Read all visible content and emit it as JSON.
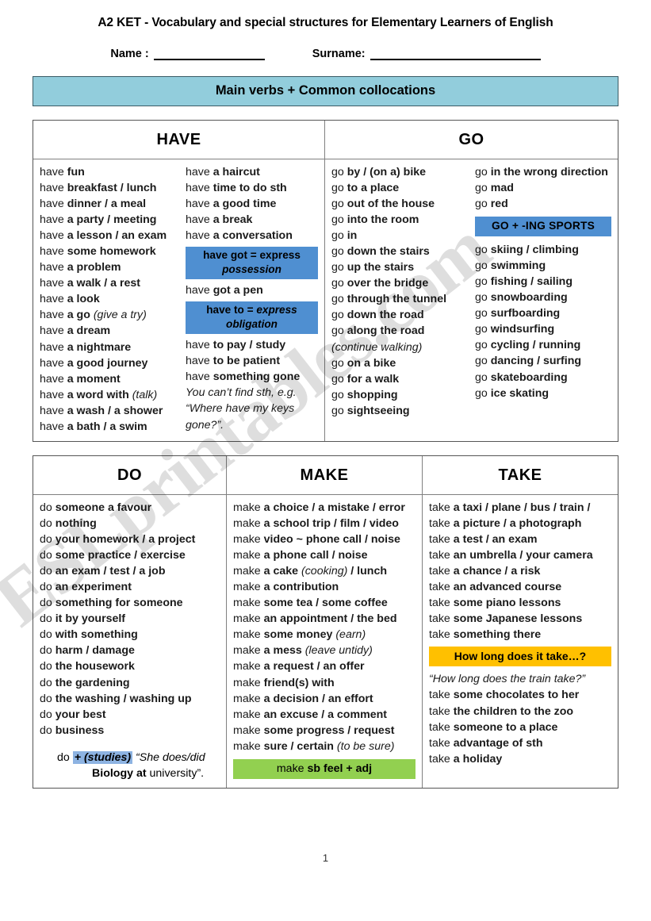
{
  "header": {
    "title": "A2 KET - Vocabulary and special structures for Elementary Learners of English",
    "name_label": "Name :",
    "surname_label": "Surname:",
    "banner": "Main verbs + Common collocations"
  },
  "colors": {
    "banner_bg": "#92CDDC",
    "blue_box": "#4F8FD1",
    "amber_box": "#FFC000",
    "green_box": "#92D050",
    "inline_highlight": "#8DB3E2",
    "table_border": "#555555"
  },
  "tables": [
    {
      "id": "table-verbs-1",
      "headers": [
        "HAVE",
        "GO"
      ],
      "columns": [
        {
          "id": "have-col-1",
          "items": [
            {
              "type": "entry",
              "verb": "have ",
              "coll": "fun"
            },
            {
              "type": "entry",
              "verb": "have ",
              "coll": "breakfast / lunch"
            },
            {
              "type": "entry",
              "verb": "have ",
              "coll": "dinner / a meal"
            },
            {
              "type": "entry",
              "verb": "have ",
              "coll": "a party / meeting"
            },
            {
              "type": "entry",
              "verb": "have ",
              "coll": "a lesson / an exam"
            },
            {
              "type": "entry",
              "verb": "have ",
              "coll": "some homework"
            },
            {
              "type": "entry",
              "verb": "have ",
              "coll": "a problem"
            },
            {
              "type": "entry",
              "verb": "have ",
              "coll": "a walk / a rest"
            },
            {
              "type": "entry",
              "verb": "have ",
              "coll": "a look"
            },
            {
              "type": "entry",
              "verb": "have ",
              "coll": "a go",
              "note": " (give a try)"
            },
            {
              "type": "entry",
              "verb": "have ",
              "coll": "a dream"
            },
            {
              "type": "entry",
              "verb": "have ",
              "coll": "a nightmare"
            },
            {
              "type": "entry",
              "verb": "have ",
              "coll": "a good journey"
            },
            {
              "type": "entry",
              "verb": "have ",
              "coll": "a moment"
            },
            {
              "type": "entry",
              "verb": "have ",
              "coll": "a word with ",
              "note": "(talk)"
            },
            {
              "type": "entry",
              "verb": "have ",
              "coll": "a wash / a shower"
            },
            {
              "type": "entry",
              "verb": "have ",
              "coll": "a bath / a swim"
            }
          ]
        },
        {
          "id": "have-col-2",
          "items": [
            {
              "type": "entry",
              "verb": "have ",
              "coll": "a haircut"
            },
            {
              "type": "entry",
              "verb": "have ",
              "coll": "time to do sth"
            },
            {
              "type": "entry",
              "verb": "have ",
              "coll": "a good time"
            },
            {
              "type": "entry",
              "verb": "have ",
              "coll": "a break"
            },
            {
              "type": "entry",
              "verb": "have ",
              "coll": "a conversation"
            },
            {
              "type": "box-blue",
              "line1": "have got = express",
              "line2": "possession"
            },
            {
              "type": "entry",
              "verb": "have ",
              "coll": "got a pen"
            },
            {
              "type": "box-blue",
              "line1": "have to = express",
              "line2": "obligation",
              "line1_italic_tail": "express"
            },
            {
              "type": "entry",
              "verb": "have ",
              "coll": "to pay / study"
            },
            {
              "type": "entry",
              "verb": "have ",
              "coll": "to be patient"
            },
            {
              "type": "entry",
              "verb": "have ",
              "coll": "something gone"
            },
            {
              "type": "italic",
              "text": "You can’t find sth, e.g. “Where have my keys gone?”."
            }
          ]
        },
        {
          "id": "go-col-1",
          "items": [
            {
              "type": "entry",
              "verb": "go ",
              "coll": "by / (on a) bike"
            },
            {
              "type": "entry",
              "verb": "go ",
              "coll": "to a place"
            },
            {
              "type": "entry",
              "verb": "go ",
              "coll": "out of the house"
            },
            {
              "type": "entry",
              "verb": "go ",
              "coll": "into the room"
            },
            {
              "type": "entry",
              "verb": "go ",
              "coll": "in"
            },
            {
              "type": "entry",
              "verb": "go ",
              "coll": "down the stairs"
            },
            {
              "type": "entry",
              "verb": "go ",
              "coll": "up the stairs"
            },
            {
              "type": "entry",
              "verb": "go ",
              "coll": "over the bridge"
            },
            {
              "type": "entry",
              "verb": "go ",
              "coll": "through the tunnel"
            },
            {
              "type": "entry",
              "verb": "go ",
              "coll": "down the road"
            },
            {
              "type": "entry",
              "verb": "go ",
              "coll": "along the road"
            },
            {
              "type": "italic-line",
              "text": "(continue walking)"
            },
            {
              "type": "entry",
              "verb": "go ",
              "coll": "on a bike"
            },
            {
              "type": "entry",
              "verb": "go ",
              "coll": "for a walk"
            },
            {
              "type": "entry",
              "verb": "go  ",
              "coll": "shopping"
            },
            {
              "type": "entry",
              "verb": "go ",
              "coll": "sightseeing"
            }
          ]
        },
        {
          "id": "go-col-2",
          "items": [
            {
              "type": "entry-wrap",
              "verb": "go ",
              "coll": "in the wrong direction"
            },
            {
              "type": "entry",
              "verb": "go ",
              "coll": "mad"
            },
            {
              "type": "entry",
              "verb": "go ",
              "coll": "red"
            },
            {
              "type": "box-sports",
              "text": "GO +  -ING SPORTS"
            },
            {
              "type": "entry",
              "verb": "go ",
              "coll": "skiing / climbing"
            },
            {
              "type": "entry",
              "verb": "go ",
              "coll": "swimming"
            },
            {
              "type": "entry",
              "verb": "go ",
              "coll": "fishing / sailing"
            },
            {
              "type": "entry",
              "verb": "go ",
              "coll": "snowboarding"
            },
            {
              "type": "entry",
              "verb": "go ",
              "coll": "surfboarding"
            },
            {
              "type": "entry",
              "verb": "go ",
              "coll": "windsurfing"
            },
            {
              "type": "entry",
              "verb": "go ",
              "coll": "cycling / running"
            },
            {
              "type": "entry",
              "verb": "go ",
              "coll": "dancing / surfing"
            },
            {
              "type": "entry",
              "verb": "go ",
              "coll": "skateboarding"
            },
            {
              "type": "entry",
              "verb": "go ",
              "coll": "ice skating"
            }
          ]
        }
      ]
    },
    {
      "id": "table-verbs-2",
      "headers": [
        "DO",
        "MAKE",
        "TAKE"
      ],
      "columns": [
        {
          "id": "do-col",
          "items": [
            {
              "type": "entry",
              "verb": "do ",
              "coll": "someone a favour"
            },
            {
              "type": "entry",
              "verb": "do ",
              "coll": "nothing"
            },
            {
              "type": "entry",
              "verb": "do ",
              "coll": "your homework / a project"
            },
            {
              "type": "entry",
              "verb": "do ",
              "coll": "some practice / exercise"
            },
            {
              "type": "entry",
              "verb": "do ",
              "coll": "an exam / test / a job"
            },
            {
              "type": "entry",
              "verb": "do ",
              "coll": "an experiment"
            },
            {
              "type": "entry",
              "verb": "do ",
              "coll": "something for someone"
            },
            {
              "type": "entry",
              "verb": "do ",
              "coll": "it by yourself"
            },
            {
              "type": "entry",
              "verb": "do ",
              "coll": "with something"
            },
            {
              "type": "entry",
              "verb": "do ",
              "coll": "harm / damage"
            },
            {
              "type": "entry",
              "verb": "do ",
              "coll": "the housework"
            },
            {
              "type": "entry",
              "verb": "do ",
              "coll": "the gardening"
            },
            {
              "type": "entry",
              "verb": "do ",
              "coll": "the washing / washing up"
            },
            {
              "type": "entry",
              "verb": "do ",
              "coll": "your best"
            },
            {
              "type": "entry",
              "verb": "do ",
              "coll": "business"
            },
            {
              "type": "studies",
              "verb": "do ",
              "highlight": "+ (studies)",
              "quote1": "“She does/did",
              "bold2": "Biology at",
              "rest2": "university”."
            }
          ]
        },
        {
          "id": "make-col",
          "items": [
            {
              "type": "entry",
              "verb": "make ",
              "coll": "a choice / a mistake / error"
            },
            {
              "type": "entry",
              "verb": "make ",
              "coll": "a school trip / film / video"
            },
            {
              "type": "entry",
              "verb": "make ",
              "coll": "video ~ phone call / noise"
            },
            {
              "type": "entry",
              "verb": "make ",
              "coll": "a phone call / noise"
            },
            {
              "type": "entry",
              "verb": "make ",
              "coll": "a cake ",
              "note": "(cooking)",
              "coll2": " / lunch"
            },
            {
              "type": "entry",
              "verb": "make ",
              "coll": "a contribution"
            },
            {
              "type": "entry",
              "verb": "make ",
              "coll": "some tea / some coffee"
            },
            {
              "type": "entry",
              "verb": "make ",
              "coll": "an appointment / the bed"
            },
            {
              "type": "entry",
              "verb": "make ",
              "coll": "some money ",
              "note": "(earn)"
            },
            {
              "type": "entry",
              "verb": "make ",
              "coll": "a mess ",
              "note": "(leave untidy)"
            },
            {
              "type": "entry",
              "verb": "make ",
              "coll": "a request / an offer"
            },
            {
              "type": "entry",
              "verb": "make ",
              "coll": "friend(s) with"
            },
            {
              "type": "entry",
              "verb": "make ",
              "coll": "a decision / an effort"
            },
            {
              "type": "entry",
              "verb": "make ",
              "coll": "an excuse / a comment"
            },
            {
              "type": "entry",
              "verb": "make ",
              "coll": "some progress / request"
            },
            {
              "type": "entry",
              "verb": "make ",
              "coll": "sure / certain ",
              "note": "(to be sure)"
            },
            {
              "type": "box-green",
              "verb": "make ",
              "coll": "sb feel + adj"
            }
          ]
        },
        {
          "id": "take-col",
          "items": [
            {
              "type": "entry",
              "verb": "take ",
              "coll": "a taxi / plane / bus / train /"
            },
            {
              "type": "entry",
              "verb": "take ",
              "coll": "a picture / a photograph"
            },
            {
              "type": "entry",
              "verb": "take ",
              "coll": "a test / an exam"
            },
            {
              "type": "entry",
              "verb": "take ",
              "coll": "an umbrella / your camera"
            },
            {
              "type": "entry",
              "verb": "take ",
              "coll": "a chance / a risk"
            },
            {
              "type": "entry",
              "verb": "take ",
              "coll": "an advanced course"
            },
            {
              "type": "entry",
              "verb": "take ",
              "coll": "some piano lessons"
            },
            {
              "type": "entry",
              "verb": "take ",
              "coll": "some Japanese lessons"
            },
            {
              "type": "entry",
              "verb": "take ",
              "coll": "something there"
            },
            {
              "type": "box-amber",
              "text": "How long does it take…?"
            },
            {
              "type": "italic-line",
              "text": "“How long does the train take?”"
            },
            {
              "type": "entry",
              "verb": "take ",
              "coll": "some chocolates to her"
            },
            {
              "type": "entry",
              "verb": "take ",
              "coll": "the children to the zoo"
            },
            {
              "type": "entry",
              "verb": "take ",
              "coll": "someone to a place"
            },
            {
              "type": "entry",
              "verb": "take ",
              "coll": "advantage of sth"
            },
            {
              "type": "entry",
              "verb": "take ",
              "coll": "a holiday"
            }
          ]
        }
      ]
    }
  ],
  "footer": {
    "page_number": "1"
  },
  "watermark": {
    "text": "ESLprintables.com"
  }
}
